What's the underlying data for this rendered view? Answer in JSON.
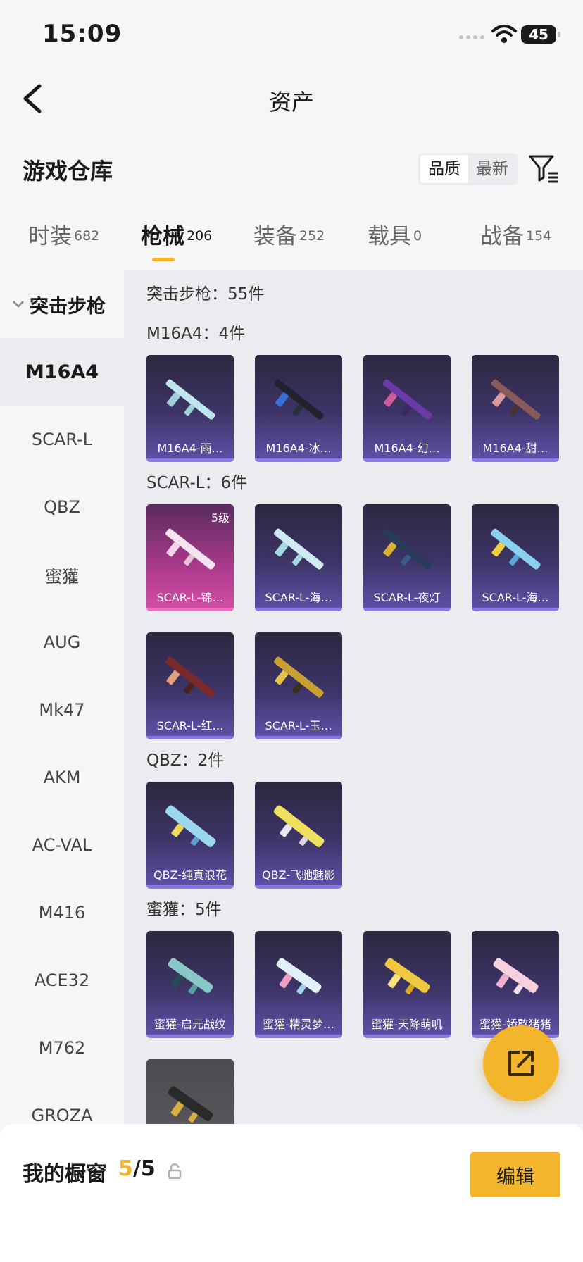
{
  "status": {
    "time": "15:09",
    "battery": "45"
  },
  "nav": {
    "title": "资产"
  },
  "warehouse": {
    "title": "游戏仓库",
    "sort_quality": "品质",
    "sort_newest": "最新"
  },
  "tabs": [
    {
      "label": "时装",
      "count": "682"
    },
    {
      "label": "枪械",
      "count": "206"
    },
    {
      "label": "装备",
      "count": "252"
    },
    {
      "label": "载具",
      "count": "0"
    },
    {
      "label": "战备",
      "count": "154"
    }
  ],
  "sidebar": {
    "group": "突击步枪",
    "items": [
      "M16A4",
      "SCAR-L",
      "QBZ",
      "蜜獾",
      "AUG",
      "Mk47",
      "AKM",
      "AC-VAL",
      "M416",
      "ACE32",
      "M762",
      "GROZA"
    ]
  },
  "main": {
    "total": "突击步枪：55件",
    "sections": [
      {
        "label": "M16A4：4件",
        "cards": [
          "M16A4-雨…",
          "M16A4-冰…",
          "M16A4-幻…",
          "M16A4-甜…"
        ]
      },
      {
        "label": "SCAR-L：6件",
        "badge": "5级",
        "cards": [
          "SCAR-L-锦…",
          "SCAR-L-海…",
          "SCAR-L-夜灯",
          "SCAR-L-海…",
          "SCAR-L-红…",
          "SCAR-L-玉…"
        ]
      },
      {
        "label": "QBZ：2件",
        "cards": [
          "QBZ-纯真浪花",
          "QBZ-飞驰魅影"
        ]
      },
      {
        "label": "蜜獾：5件",
        "cards": [
          "蜜獾-启元战纹",
          "蜜獾-精灵梦…",
          "蜜獾-天降萌叽",
          "蜜獾-娇憨猪猪"
        ]
      }
    ]
  },
  "showcase": {
    "label": "我的橱窗",
    "current": "5",
    "total": "/5",
    "edit": "编辑"
  },
  "colors": {
    "accent": "#f3b52b",
    "card_purple": "#5e50a6",
    "card_pink": "#d14fa4"
  }
}
